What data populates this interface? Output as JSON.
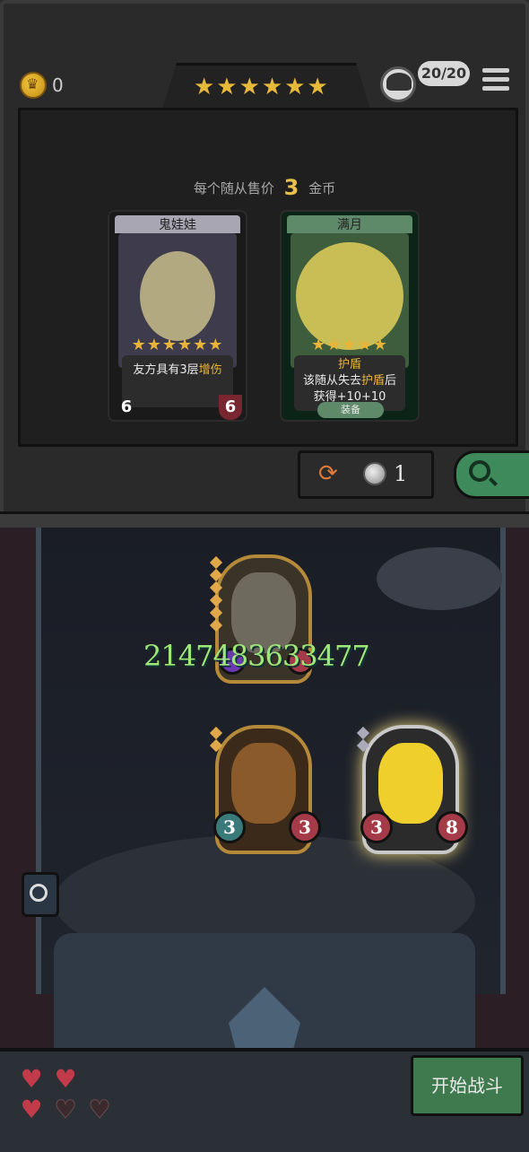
{
  "header": {
    "coins": "0",
    "stars": "★★★★★★",
    "lives_badge": "20/20"
  },
  "shop": {
    "sell_prefix": "每个随从售价",
    "sell_amount": "3",
    "sell_suffix": "金币",
    "cards": [
      {
        "name": "鬼娃娃",
        "stars": "★★★★★★",
        "desc_before": "友方具有3层",
        "desc_highlight": "增伤",
        "desc_after": "",
        "attack": "6",
        "health": "6"
      },
      {
        "name": "满月",
        "stars": "★★★★★",
        "desc_title": "护盾",
        "desc_line1_before": "该随从失去",
        "desc_line1_highlight": "护盾",
        "desc_line1_after": "后",
        "desc_line2": "获得+10+10",
        "tag": "装备"
      }
    ],
    "refresh_cost": "1"
  },
  "board": {
    "overflow_number": "2147483633477",
    "units": [
      {
        "attack": "",
        "health": ""
      },
      {
        "attack": "3",
        "health": "3"
      },
      {
        "attack": "3",
        "health": "8"
      }
    ]
  },
  "footer": {
    "hearts_full": 3,
    "hearts_total": 5,
    "start_button": "开始战斗"
  },
  "colors": {
    "gold": "#e8b43a",
    "atk_blue": "#4d7fa3",
    "hp_red": "#a53a48",
    "start_green": "#3f7a4f",
    "damage_green": "#9ee87a"
  }
}
